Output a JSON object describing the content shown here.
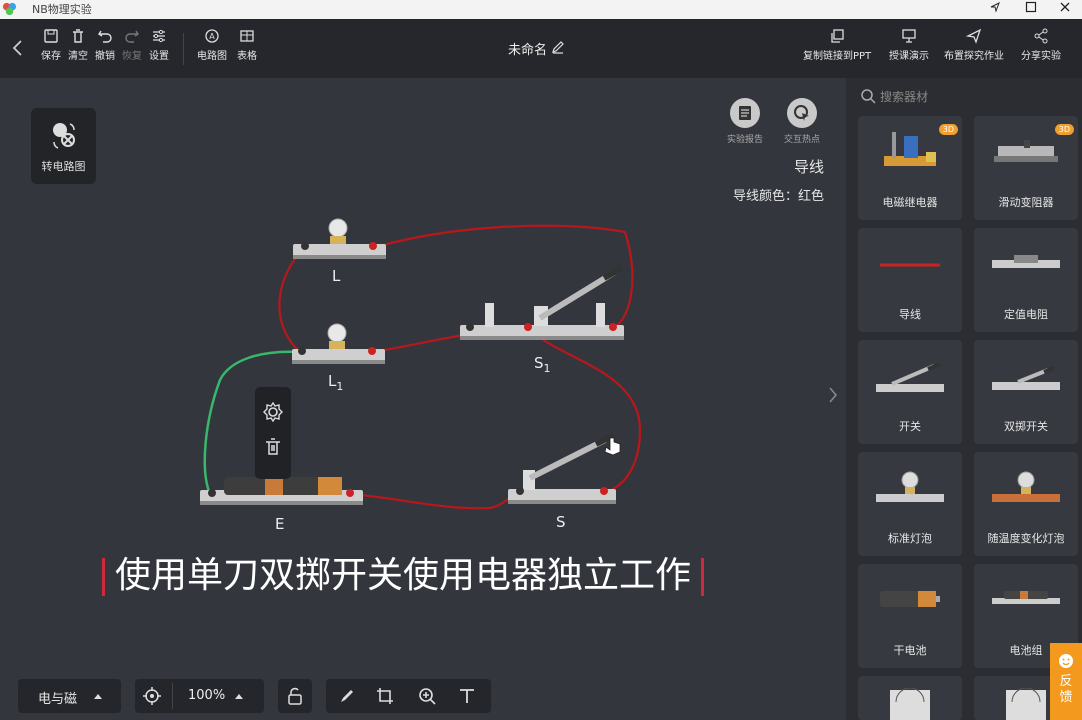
{
  "window": {
    "title": "NB物理实验",
    "controls": [
      "pin",
      "maximize",
      "close"
    ]
  },
  "toolbar": {
    "save": "保存",
    "clear": "清空",
    "undo": "撤销",
    "redo": "恢复",
    "settings": "设置",
    "circuit": "电路图",
    "table": "表格",
    "doc_title": "未命名",
    "copy_ppt": "复制链接到PPT",
    "teach": "授课演示",
    "assign": "布置探究作业",
    "share": "分享实验"
  },
  "canvas": {
    "convert_label": "转电路图",
    "report": "实验报告",
    "hotspot": "交互热点",
    "selected_type": "导线",
    "wire_color": "导线颜色：红色",
    "labels": {
      "L": "L",
      "L1_main": "L",
      "L1_sub": "1",
      "S1_main": "S",
      "S1_sub": "1",
      "S": "S",
      "E": "E"
    },
    "subtitle": "使用单刀双掷开关使用电器独立工作"
  },
  "sidepanel": {
    "search_placeholder": "搜索器材",
    "items": [
      {
        "label": "电磁继电器",
        "badge": "3D"
      },
      {
        "label": "滑动变阻器",
        "badge": "3D"
      },
      {
        "label": "导线"
      },
      {
        "label": "定值电阻"
      },
      {
        "label": "开关"
      },
      {
        "label": "双掷开关"
      },
      {
        "label": "标准灯泡"
      },
      {
        "label": "随温度变化灯泡"
      },
      {
        "label": "干电池"
      },
      {
        "label": "电池组"
      }
    ],
    "feedback": "反馈"
  },
  "bottombar": {
    "category": "电与磁",
    "zoom": "100%"
  }
}
